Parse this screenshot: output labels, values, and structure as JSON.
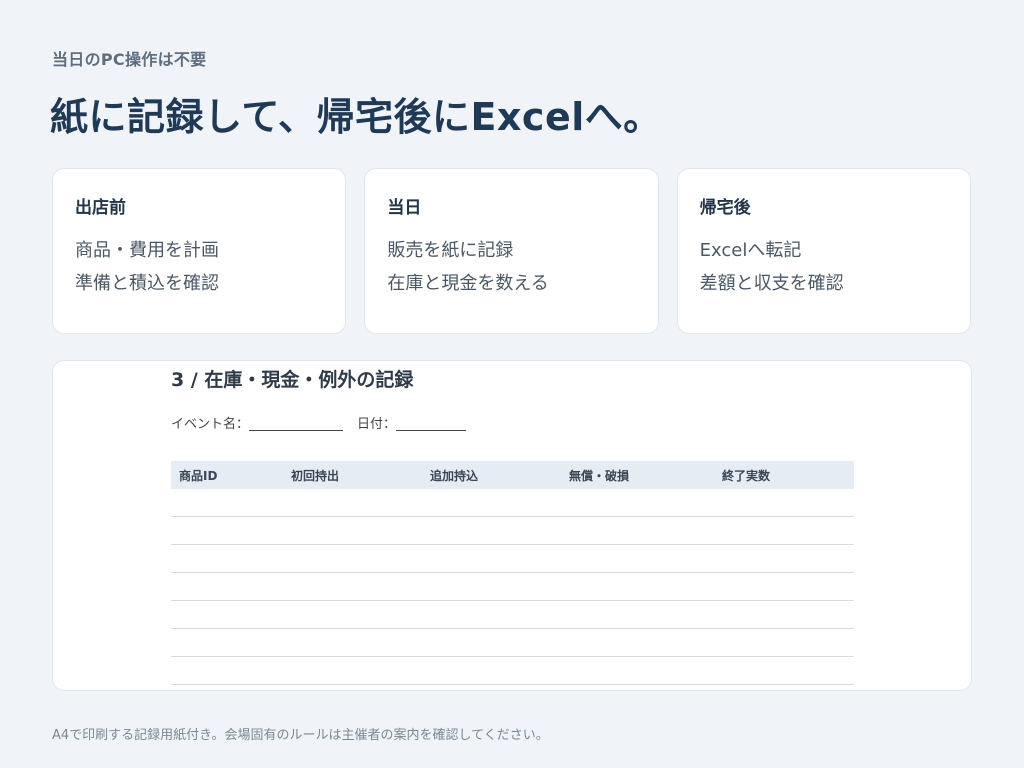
{
  "header": {
    "eyebrow": "当日のPC操作は不要",
    "headline": "紙に記録して、帰宅後にExcelへ。"
  },
  "cards": [
    {
      "title": "出店前",
      "lines": [
        "商品・費用を計画",
        "準備と積込を確認"
      ]
    },
    {
      "title": "当日",
      "lines": [
        "販売を紙に記録",
        "在庫と現金を数える"
      ]
    },
    {
      "title": "帰宅後",
      "lines": [
        "Excelへ転記",
        "差額と収支を確認"
      ]
    }
  ],
  "sheet": {
    "title": "3 / 在庫・現金・例外の記録",
    "event_label": "イベント名：",
    "date_label": "日付：",
    "columns": [
      "商品ID",
      "初回持出",
      "追加持込",
      "無償・破損",
      "終了実数"
    ],
    "empty_rows": 7
  },
  "footnote": "A4で印刷する記録用紙付き。会場固有のルールは主催者の案内を確認してください。"
}
